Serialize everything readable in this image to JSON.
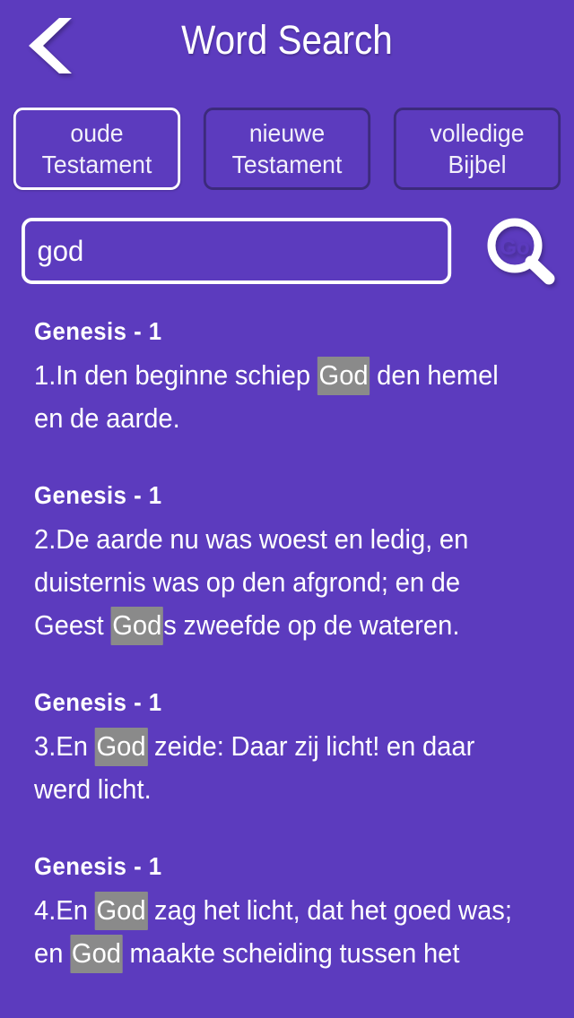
{
  "theme": {
    "background": "#5c3bbe",
    "text": "#ffffff",
    "tab_border_inactive": "#3c2a7c",
    "tab_border_active": "#ffffff",
    "highlight_background": "#8a8a8a"
  },
  "header": {
    "title": "Word Search",
    "back_icon": "chevron-left-icon"
  },
  "tabs": [
    {
      "line1": "oude",
      "line2": "Testament",
      "selected": true
    },
    {
      "line1": "nieuwe",
      "line2": "Testament",
      "selected": false
    },
    {
      "line1": "volledige",
      "line2": "Bijbel",
      "selected": false
    }
  ],
  "search": {
    "value": "god",
    "placeholder": "",
    "go_label": "Go",
    "go_icon": "search-go-icon"
  },
  "results": [
    {
      "reference": "Genesis - 1",
      "parts": [
        {
          "t": "1.In den beginne schiep ",
          "hl": false
        },
        {
          "t": "God",
          "hl": true
        },
        {
          "t": " den hemel en de aarde.",
          "hl": false
        }
      ]
    },
    {
      "reference": "Genesis - 1",
      "parts": [
        {
          "t": "2.De aarde nu was woest en ledig, en duisternis was op den afgrond; en de Geest ",
          "hl": false
        },
        {
          "t": "God",
          "hl": true
        },
        {
          "t": "s zweefde op de wateren.",
          "hl": false
        }
      ]
    },
    {
      "reference": "Genesis - 1",
      "parts": [
        {
          "t": "3.En ",
          "hl": false
        },
        {
          "t": "God",
          "hl": true
        },
        {
          "t": " zeide: Daar zij licht! en daar werd licht.",
          "hl": false
        }
      ]
    },
    {
      "reference": "Genesis - 1",
      "parts": [
        {
          "t": "4.En ",
          "hl": false
        },
        {
          "t": "God",
          "hl": true
        },
        {
          "t": " zag het licht, dat het goed was; en ",
          "hl": false
        },
        {
          "t": "God",
          "hl": true
        },
        {
          "t": " maakte scheiding tussen het",
          "hl": false
        }
      ]
    }
  ]
}
